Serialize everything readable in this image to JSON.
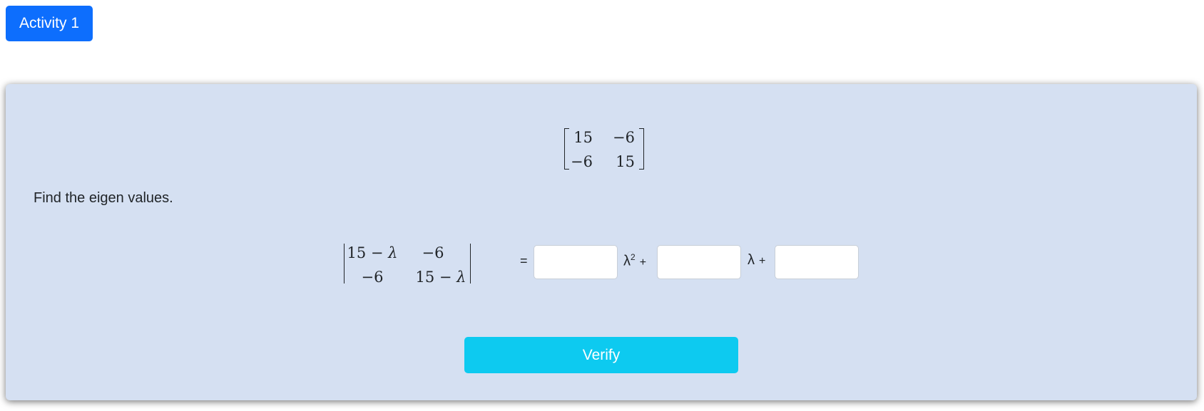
{
  "header": {
    "activity_label": "Activity 1"
  },
  "matrix": {
    "rows": [
      [
        "15",
        "−6"
      ],
      [
        "−6",
        "15"
      ]
    ]
  },
  "prompt": "Find the eigen values.",
  "determinant": {
    "rows": [
      [
        "15 − λ",
        "−6"
      ],
      [
        "−6",
        "15 − λ"
      ]
    ]
  },
  "equation": {
    "equals": "=",
    "lambda_squared": "λ",
    "exponent": "2",
    "plus1": "+",
    "lambda": "λ",
    "plus2": "+",
    "inputs": [
      "",
      "",
      ""
    ]
  },
  "verify_label": "Verify",
  "colors": {
    "activity_button": "#0d6efd",
    "panel_background": "#d5e0f2",
    "verify_button": "#0dcaf0"
  }
}
